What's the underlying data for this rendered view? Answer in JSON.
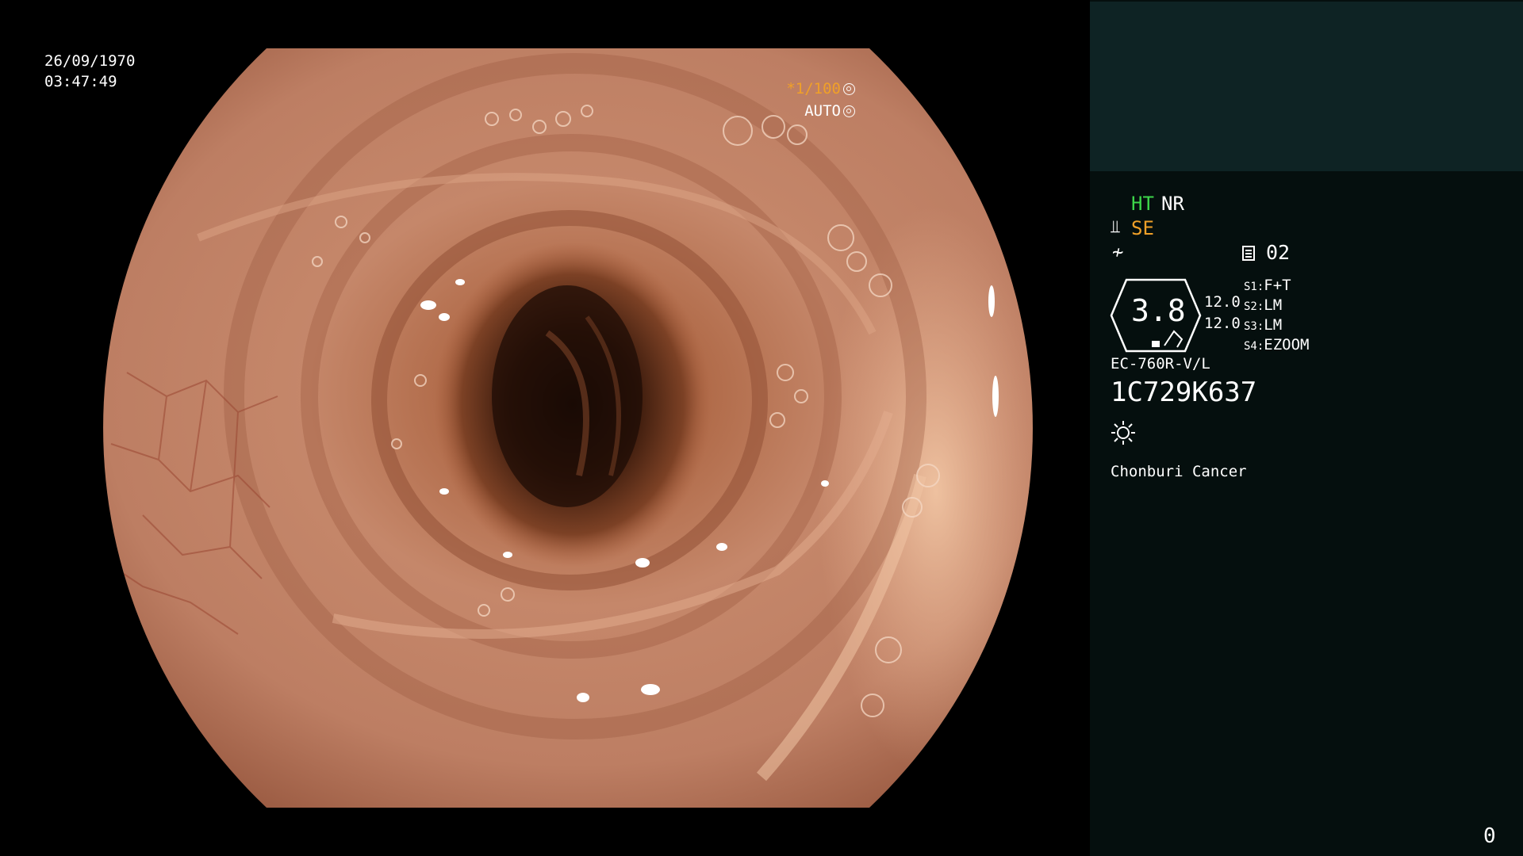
{
  "overlay": {
    "date": "26/09/1970",
    "time": "03:47:49",
    "shutter_ratio": "*1/100",
    "mode": "AUTO"
  },
  "panel": {
    "ht_label": "HT",
    "nr_label": "NR",
    "se_label": "SE",
    "memory_number": "02",
    "zoom_value": "3.8",
    "setting_a": "12.0",
    "setting_b": "12.0",
    "switches": [
      {
        "label": "S1:",
        "value": "F+T"
      },
      {
        "label": "S2:",
        "value": "LM"
      },
      {
        "label": "S3:",
        "value": "LM"
      },
      {
        "label": "S4:",
        "value": "EZOOM"
      }
    ],
    "scope_model": "EC-760R-V/L",
    "scope_serial": "1C729K637",
    "institution": "Chonburi Cancer",
    "counter": "0"
  },
  "colors": {
    "ht_green": "#3dd64a",
    "accent_orange": "#f0a028",
    "panel_top": "#0e2324",
    "panel_bg": "#050f0e",
    "mucosa": "#c4876a"
  },
  "icons": [
    "aperture-icon",
    "iris-icon",
    "scope-se-icon",
    "nf-icon",
    "memory-icon",
    "light-source-icon"
  ]
}
